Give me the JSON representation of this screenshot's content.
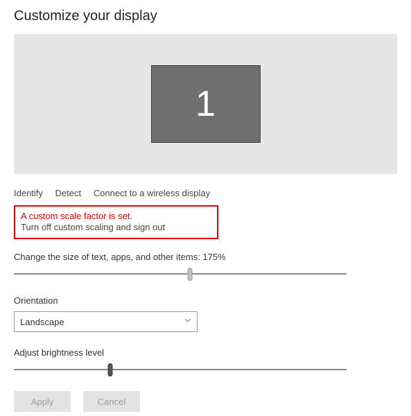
{
  "title": "Customize your display",
  "monitor": {
    "number": "1"
  },
  "links": {
    "identify": "Identify",
    "detect": "Detect",
    "connect": "Connect to a wireless display"
  },
  "warning": {
    "line1": "A custom scale factor is set.",
    "line2": "Turn off custom scaling and sign out"
  },
  "scale": {
    "label": "Change the size of text, apps, and other items: 175%",
    "percent": 53
  },
  "orientation": {
    "label": "Orientation",
    "value": "Landscape"
  },
  "brightness": {
    "label": "Adjust brightness level",
    "percent": 29
  },
  "buttons": {
    "apply": "Apply",
    "cancel": "Cancel"
  }
}
